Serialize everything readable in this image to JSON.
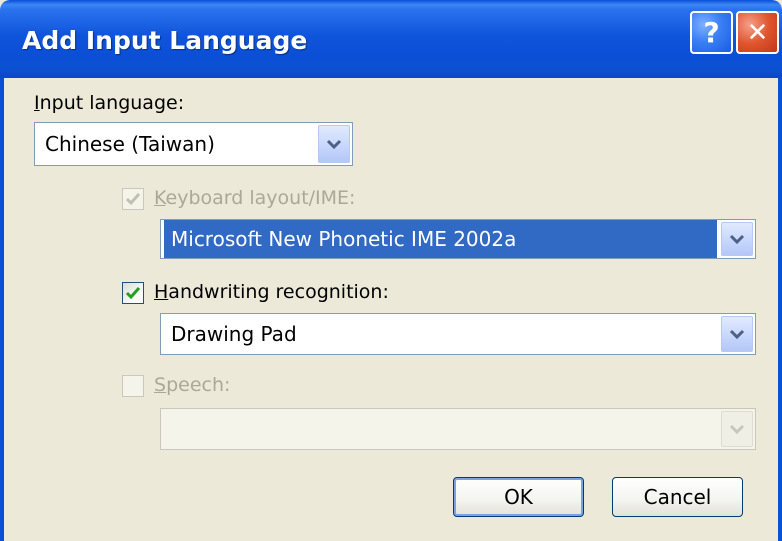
{
  "window": {
    "title": "Add Input Language",
    "help_glyph": "?",
    "close_glyph": "✕"
  },
  "input_language": {
    "label_accel": "I",
    "label_rest": "nput language:",
    "value": "Chinese (Taiwan)"
  },
  "keyboard_layout": {
    "checked": true,
    "enabled": false,
    "label_accel": "K",
    "label_rest": "eyboard layout/IME:",
    "value": "Microsoft New Phonetic IME 2002a"
  },
  "handwriting": {
    "checked": true,
    "enabled": true,
    "label_accel": "H",
    "label_rest": "andwriting recognition:",
    "value": "Drawing Pad"
  },
  "speech": {
    "checked": false,
    "enabled": false,
    "label_accel": "S",
    "label_rest": "peech:",
    "value": ""
  },
  "buttons": {
    "ok": "OK",
    "cancel": "Cancel"
  },
  "colors": {
    "titlebar": "#0a4fd8",
    "dialog_bg": "#ece9d8",
    "selection": "#316ac5",
    "check_green": "#21a121",
    "disabled_text": "#aca899"
  }
}
